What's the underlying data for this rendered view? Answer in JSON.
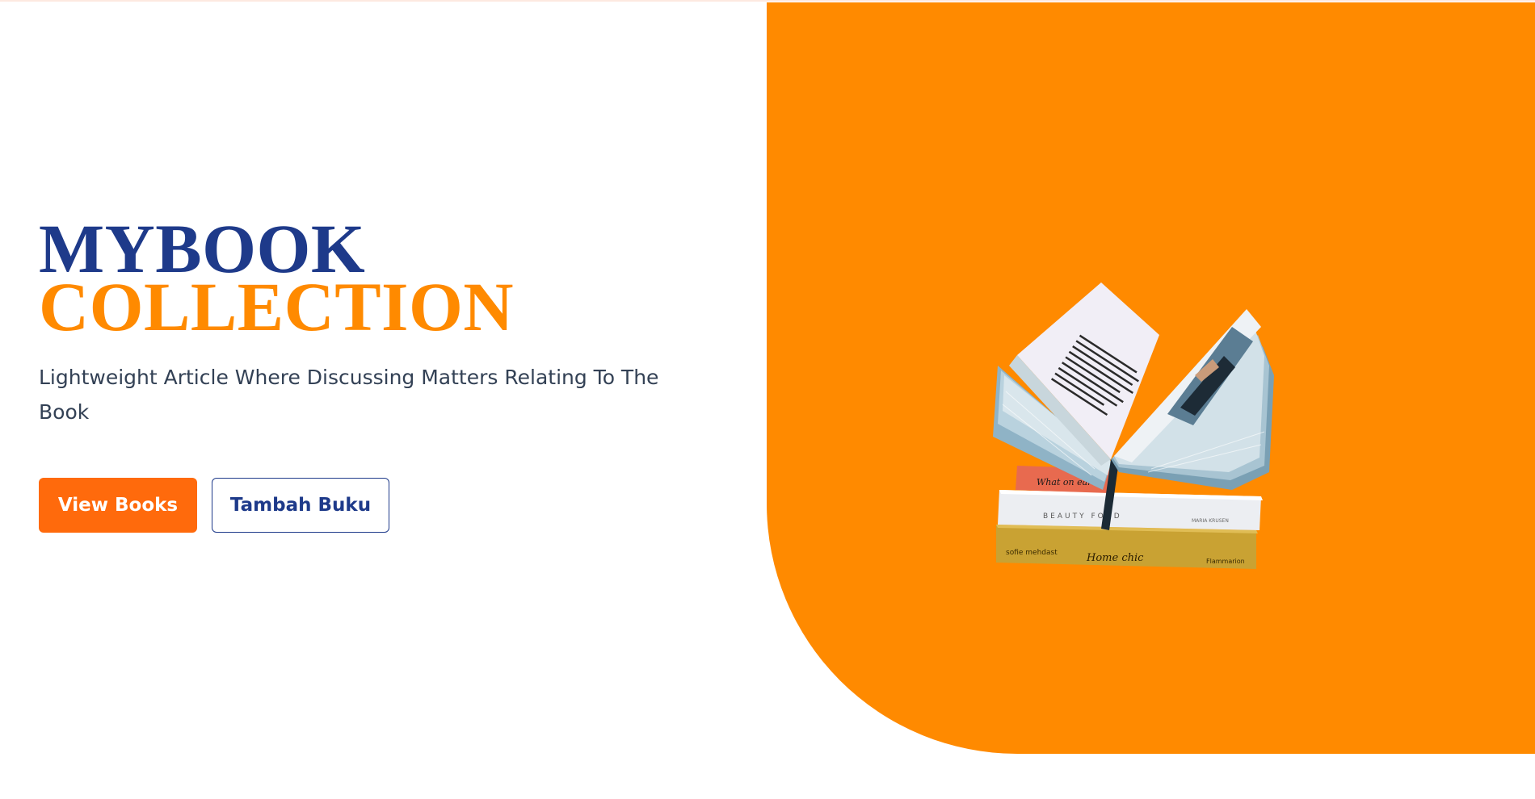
{
  "hero": {
    "title_line1": "MYBOOK",
    "title_line2": "COLLECTION",
    "subtitle": "Lightweight Article Where Discussing Matters Relating To The Book",
    "primary_button": "View Books",
    "secondary_button": "Tambah Buku"
  },
  "illustration": {
    "icon": "open-book-stack-illustration",
    "spine_text": "BEAUTY FOOD",
    "bottom_book_text": "Home chic",
    "red_book_text": "What on earth"
  },
  "colors": {
    "primary_navy": "#1e3a8a",
    "accent_orange": "#ff8a00",
    "button_orange": "#ff6a0c"
  }
}
